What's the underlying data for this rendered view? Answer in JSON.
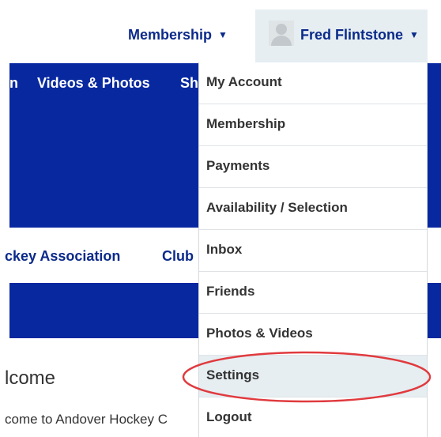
{
  "header": {
    "membership_label": "Membership",
    "user_name": "Fred Flintstone"
  },
  "main_nav": {
    "items": [
      {
        "label": "n"
      },
      {
        "label": "Videos & Photos"
      },
      {
        "label": "Sh"
      }
    ]
  },
  "sub_nav": {
    "items": [
      {
        "label": "ckey Association"
      },
      {
        "label": "Club"
      }
    ]
  },
  "content": {
    "heading": "lcome",
    "text": "come to Andover Hockey C"
  },
  "user_menu": {
    "items": [
      {
        "label": "My Account"
      },
      {
        "label": "Membership"
      },
      {
        "label": "Payments"
      },
      {
        "label": "Availability / Selection"
      },
      {
        "label": "Inbox"
      },
      {
        "label": "Friends"
      },
      {
        "label": "Photos & Videos"
      },
      {
        "label": "Settings"
      },
      {
        "label": "Logout"
      }
    ],
    "highlighted": "Settings"
  },
  "colors": {
    "brand_blue": "#0828a0",
    "link_blue": "#0b2a8a",
    "annotation_red": "#e03a3e",
    "highlight_bg": "#e6eef2"
  }
}
